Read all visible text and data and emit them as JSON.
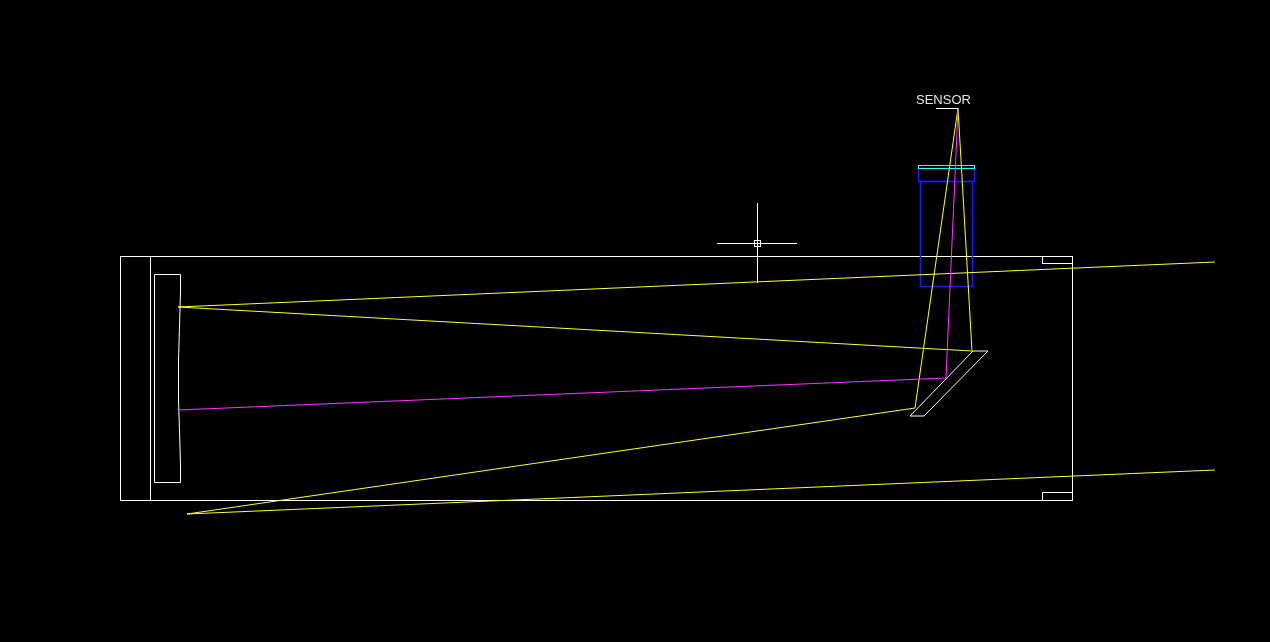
{
  "canvas": {
    "label": "SENSOR"
  }
}
